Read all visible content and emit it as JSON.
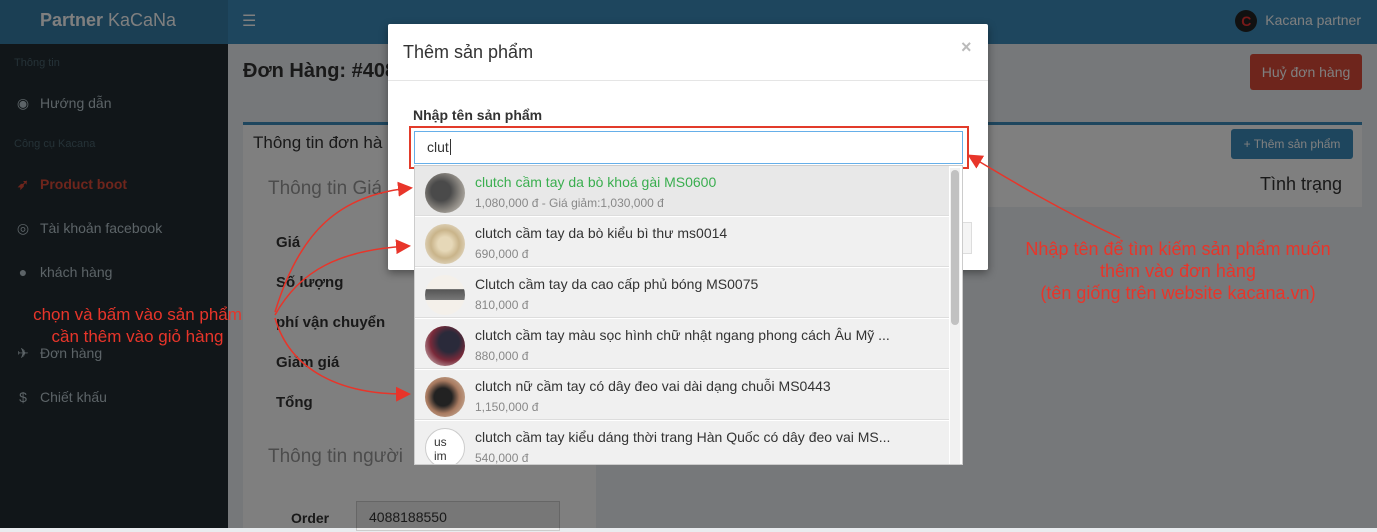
{
  "app": {
    "brand_bold": "Partner",
    "brand_rest": " KaCaNa",
    "user_name": "Kacana partner",
    "avatar_letter": "C"
  },
  "sidebar": {
    "header_info": "Thông tin",
    "header_tools": "Công cụ Kacana",
    "items": [
      {
        "label": "Hướng dẫn",
        "icon": "dashboard-icon",
        "glyph": "◉"
      },
      {
        "label": "Product boot",
        "icon": "rocket-icon",
        "glyph": "🚀"
      },
      {
        "label": "Tài khoản facebook",
        "icon": "globe-icon",
        "glyph": "◎"
      },
      {
        "label": "khách hàng",
        "icon": "user-icon",
        "glyph": "●"
      },
      {
        "label": "Đơn hàng",
        "icon": "plane-icon",
        "glyph": "✈"
      },
      {
        "label": "Chiết khấu",
        "icon": "dollar-icon",
        "glyph": "$"
      }
    ]
  },
  "page": {
    "title": "Đơn Hàng: #408",
    "cancel_button": "Huỷ đơn hàng",
    "box_title": "Thông tin đơn hà",
    "add_product_button": "+ Thêm sản phẩm",
    "status_header": "Tình trạng",
    "panel_heading": "Thông tin Giá",
    "rows": [
      "Giá",
      "Số lượng",
      "phí vận chuyển",
      "Giảm giá",
      "Tổng"
    ],
    "customer_heading": "Thông tin người",
    "order_label": "Order",
    "order_value": "4088188550"
  },
  "modal": {
    "title": "Thêm sản phẩm",
    "close": "×",
    "input_label": "Nhập tên sản phẩm",
    "input_value": "clut"
  },
  "results": [
    {
      "name": "clutch cầm tay da bò khoá gài MS0600",
      "price": "1,080,000 đ - Giá giảm:1,030,000 đ",
      "highlight": true
    },
    {
      "name": "clutch cầm tay da bò kiểu bì thư ms0014",
      "price": "690,000 đ",
      "highlight": false
    },
    {
      "name": "Clutch cầm tay da cao cấp phủ bóng MS0075",
      "price": "810,000 đ",
      "highlight": false
    },
    {
      "name": "clutch cầm tay màu sọc hình chữ nhật ngang phong cách Âu Mỹ ...",
      "price": "880,000 đ",
      "highlight": false
    },
    {
      "name": "clutch nữ cầm tay có dây đeo vai dài dạng chuỗi MS0443",
      "price": "1,150,000 đ",
      "highlight": false
    },
    {
      "name": "clutch cầm tay kiểu dáng thời trang Hàn Quốc có dây đeo vai MS...",
      "price": "540,000 đ",
      "highlight": false
    }
  ],
  "broken_image_text": "us\nim",
  "annotations": {
    "left_line1": "chọn và bấm vào sản phẩm",
    "left_line2": "cần thêm vào giỏ hàng",
    "right_line1": "Nhập tên để tìm kiếm sản phẩm muốn",
    "right_line2": "thêm vào đơn hàng",
    "right_line3": "(tên giống trên website kacana.vn)",
    "color": "#e8352a"
  }
}
